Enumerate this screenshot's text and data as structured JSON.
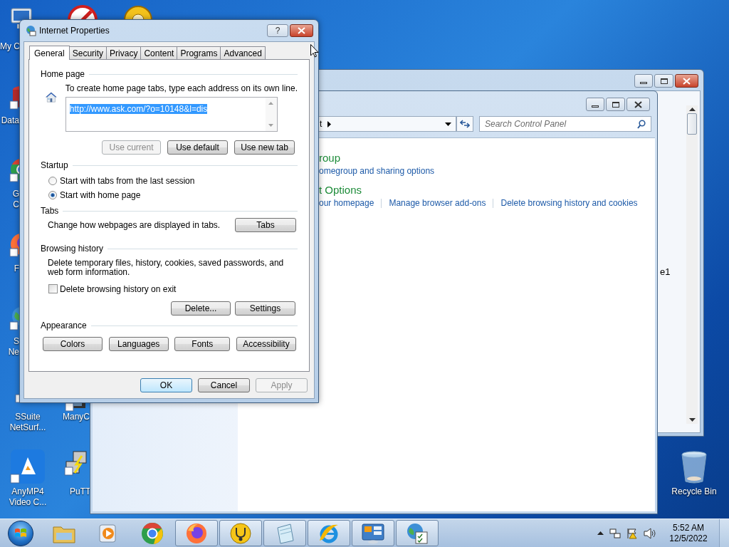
{
  "desktop_icons": [
    {
      "kind": "computer",
      "lines": [
        "My C"
      ]
    },
    {
      "kind": "no-entry"
    },
    {
      "kind": "help"
    },
    {
      "kind": "database",
      "lines": [
        "Data"
      ]
    },
    {
      "kind": "chrome",
      "lines": [
        "G",
        "C"
      ]
    },
    {
      "kind": "firefox",
      "lines": [
        "F"
      ]
    },
    {
      "kind": "globe",
      "lines": [
        "S",
        "Ne"
      ]
    },
    {
      "kind": "film",
      "lines": [
        "SSuite",
        "NetSurf..."
      ]
    },
    {
      "kind": "film",
      "lines": [
        "ManyC"
      ]
    },
    {
      "kind": "anymp4",
      "lines": [
        "AnyMP4",
        "Video C..."
      ]
    },
    {
      "kind": "putty",
      "lines": [
        "PuTT"
      ]
    },
    {
      "kind": "recycle",
      "lines": [
        "Recycle Bin"
      ]
    }
  ],
  "background_window": {
    "text_fragment": "e1"
  },
  "control_panel": {
    "address_fragment": "t",
    "search_placeholder": "Search Control Panel",
    "sections": [
      {
        "title": "roup",
        "links": [
          "omegroup and sharing options"
        ]
      },
      {
        "title": "t Options",
        "links": [
          "our homepage",
          "Manage browser add-ons",
          "Delete browsing history and cookies"
        ]
      }
    ]
  },
  "dialog": {
    "title": "Internet Properties",
    "help": "?",
    "tabs": [
      {
        "label": "General",
        "selected": true
      },
      {
        "label": "Security",
        "selected": false
      },
      {
        "label": "Privacy",
        "selected": false
      },
      {
        "label": "Content",
        "selected": false
      },
      {
        "label": "Programs",
        "selected": false
      },
      {
        "label": "Advanced",
        "selected": false
      }
    ],
    "home_page": {
      "legend": "Home page",
      "hint": "To create home page tabs, type each address on its own line.",
      "value": "http://www.ask.com/?o=10148&l=dis",
      "value_selected": true,
      "buttons": [
        {
          "label": "Use current",
          "disabled": true
        },
        {
          "label": "Use default",
          "disabled": false
        },
        {
          "label": "Use new tab",
          "disabled": false
        }
      ]
    },
    "startup": {
      "legend": "Startup",
      "options": [
        {
          "label": "Start with tabs from the last session",
          "selected": false
        },
        {
          "label": "Start with home page",
          "selected": true
        }
      ]
    },
    "tabs_section": {
      "legend": "Tabs",
      "text": "Change how webpages are displayed in tabs.",
      "button": "Tabs"
    },
    "browsing_history": {
      "legend": "Browsing history",
      "text": "Delete temporary files, history, cookies, saved passwords, and web form information.",
      "checkbox": {
        "label": "Delete browsing history on exit",
        "checked": false
      },
      "buttons": [
        "Delete...",
        "Settings"
      ]
    },
    "appearance": {
      "legend": "Appearance",
      "buttons": [
        "Colors",
        "Languages",
        "Fonts",
        "Accessibility"
      ]
    },
    "footer_buttons": [
      {
        "label": "OK",
        "default": true,
        "disabled": false
      },
      {
        "label": "Cancel",
        "default": false,
        "disabled": false
      },
      {
        "label": "Apply",
        "default": false,
        "disabled": true
      }
    ]
  },
  "taskbar": {
    "apps": [
      {
        "kind": "explorer",
        "open": false
      },
      {
        "kind": "media",
        "open": false
      },
      {
        "kind": "chrome",
        "open": false
      },
      {
        "kind": "firefox",
        "open": true
      },
      {
        "kind": "stethoscope",
        "open": true
      },
      {
        "kind": "notepad",
        "open": true
      },
      {
        "kind": "ie",
        "open": true
      },
      {
        "kind": "control-panel",
        "open": true
      },
      {
        "kind": "globe-check",
        "open": true
      }
    ],
    "clock": {
      "time": "5:52 AM",
      "date": "12/5/2022"
    }
  }
}
